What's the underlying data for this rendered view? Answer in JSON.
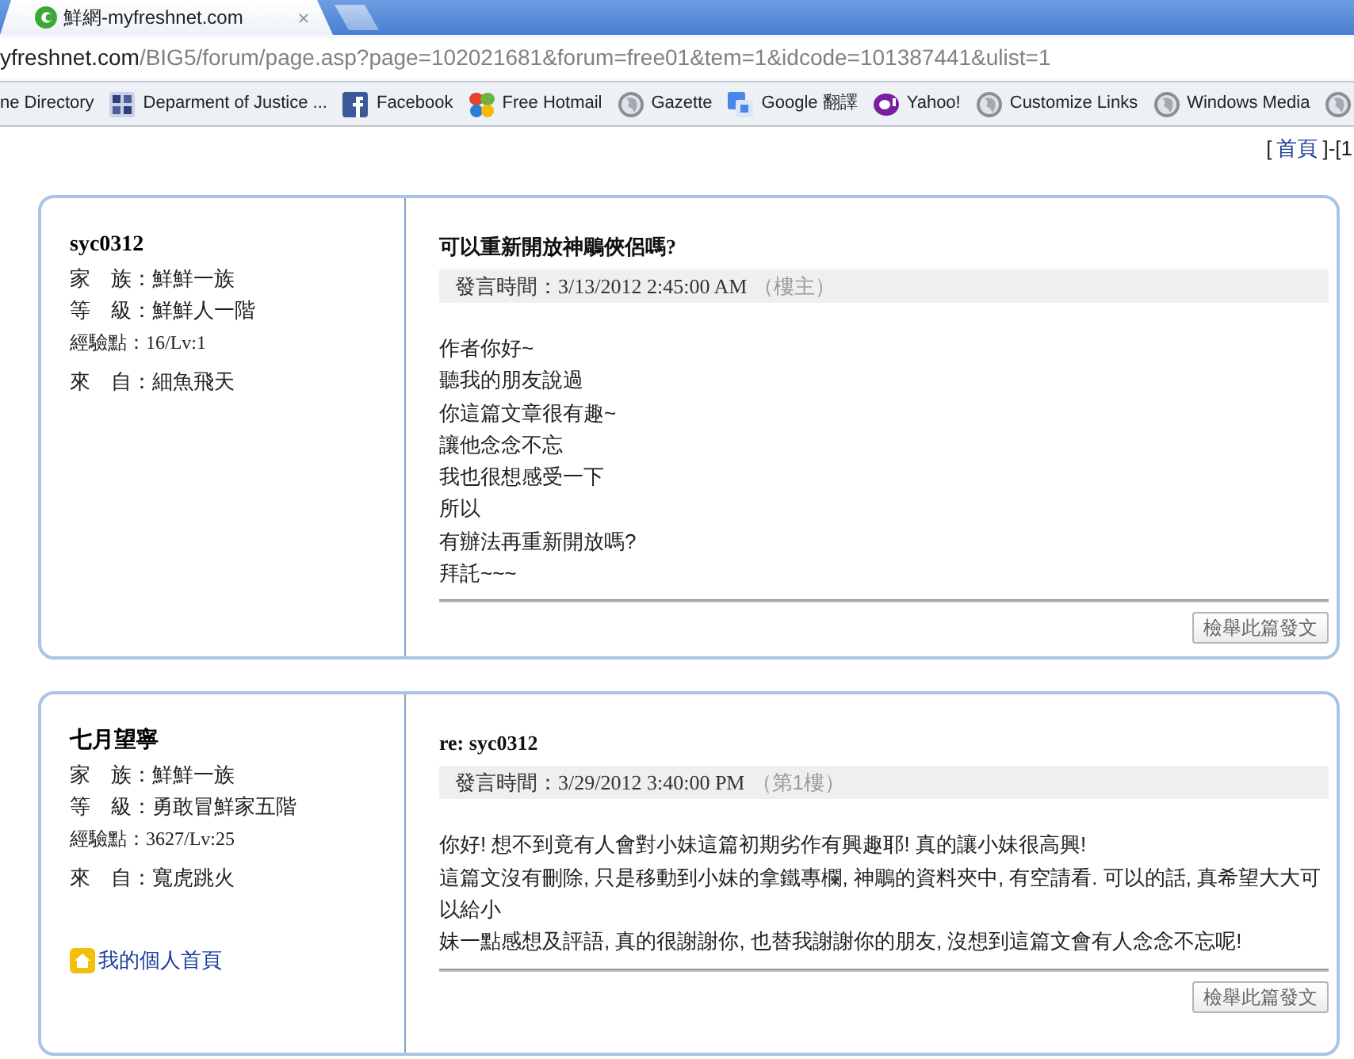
{
  "tab": {
    "title": "鮮網-myfreshnet.com"
  },
  "address_bar": {
    "host": "yfreshnet.com",
    "path": "/BIG5/forum/page.asp?page=102021681&forum=free01&tem=1&idcode=101387441&ulist=1"
  },
  "bookmarks": [
    {
      "kind": "plain",
      "label": "ne Directory"
    },
    {
      "kind": "emblem",
      "label": "Deparment of Justice ..."
    },
    {
      "kind": "square",
      "label": "Facebook"
    },
    {
      "kind": "butterfly",
      "label": "Free Hotmail"
    },
    {
      "kind": "globe",
      "label": "Gazette"
    },
    {
      "kind": "translate",
      "label": "Google 翻譯"
    },
    {
      "kind": "oval",
      "label": "Yahoo!"
    },
    {
      "kind": "globe",
      "label": "Customize Links"
    },
    {
      "kind": "globe",
      "label": "Windows Media"
    },
    {
      "kind": "globe"
    }
  ],
  "pager": {
    "open": "[",
    "link": "首頁",
    "rest": "]-[1"
  },
  "posts": [
    {
      "author": {
        "name": "syc0312",
        "fields": [
          {
            "kind": "text",
            "label": "家　族：",
            "value": "鮮鮮一族"
          },
          {
            "kind": "text",
            "label": "等　級：",
            "value": "鮮鮮人一階"
          },
          {
            "kind": "stat",
            "label": "經驗點：",
            "value": "16/Lv:1"
          },
          {
            "kind": "text",
            "label": "來　自：",
            "value": "細魚飛天"
          }
        ]
      },
      "title": "可以重新開放神鵰俠侶嗎?",
      "time_label": "發言時間：",
      "time": "3/13/2012 2:45:00 AM",
      "floor": "（樓主）",
      "body": [
        "作者你好~",
        "聽我的朋友說過",
        "你這篇文章很有趣~",
        "讓他念念不忘",
        "我也很想感受一下",
        "所以",
        "有辦法再重新開放嗎?",
        "拜託~~~"
      ],
      "report_button": "檢舉此篇發文"
    },
    {
      "author": {
        "name": "七月望寧",
        "fields": [
          {
            "kind": "text",
            "label": "家　族：",
            "value": "鮮鮮一族"
          },
          {
            "kind": "text",
            "label": "等　級：",
            "value": "勇敢冒鮮家五階"
          },
          {
            "kind": "stat",
            "label": "經驗點：",
            "value": "3627/Lv:25"
          },
          {
            "kind": "text",
            "label": "來　自：",
            "value": "寬虎跳火"
          }
        ],
        "homepage_link": "我的個人首頁"
      },
      "title": "re: syc0312",
      "time_label": "發言時間：",
      "time": "3/29/2012 3:40:00 PM",
      "floor": "（第1樓）",
      "body": [
        "你好! 想不到竟有人會對小妹這篇初期劣作有興趣耶! 真的讓小妹很高興!",
        "這篇文沒有刪除, 只是移動到小妹的拿鐵專欄, 神鵰的資料夾中, 有空請看. 可以的話, 真希望大大可以給小",
        "妹一點感想及評語, 真的很謝謝你, 也替我謝謝你的朋友, 沒想到這篇文會有人念念不忘呢!"
      ],
      "report_button": "檢舉此篇發文"
    }
  ]
}
